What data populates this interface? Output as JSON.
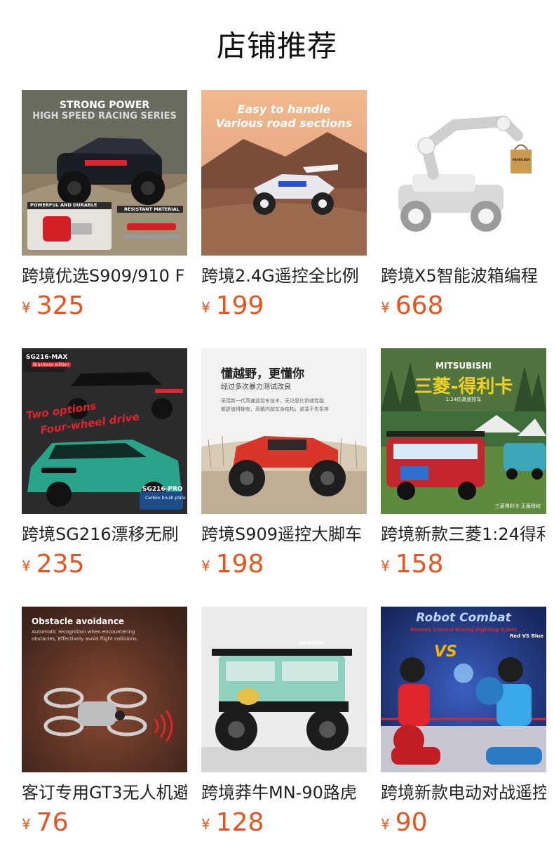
{
  "page": {
    "title": "店铺推荐"
  },
  "currency_symbol": "¥",
  "products": [
    {
      "name": "跨境优选S909/910 F",
      "price": "325",
      "image_text": {
        "line1": "STRONG POWER",
        "line2": "HIGH SPEED RACING SERIES",
        "tag1": "POWERFUL AND DURABLE",
        "tag2": "RESISTANT MATERIAL"
      },
      "colors": {
        "sky": "#6b6a5e",
        "ground": "#8d7c62",
        "car": "#1a1d24",
        "accent": "#e0242c"
      }
    },
    {
      "name": "跨境2.4G遥控全比例",
      "price": "199",
      "image_text": {
        "line1": "Easy to handle",
        "line2": "Various road sections"
      },
      "colors": {
        "sky": "#e9b48f",
        "ground": "#8a5a42",
        "car": "#e8e8ee",
        "accent": "#2a53c9"
      }
    },
    {
      "name": "跨境X5智能波箱编程",
      "price": "668",
      "image_text": {
        "label": "PAPER BOX"
      },
      "colors": {
        "sky": "#ffffff",
        "ground": "#ffffff",
        "car": "#e7e7e7",
        "accent": "#c99a4f"
      }
    },
    {
      "name": "跨境SG216漂移无刷",
      "price": "235",
      "image_text": {
        "tag_top": "SG216-MAX",
        "tag_top_sub": "Brushless edition",
        "line1": "Two options",
        "line2": "Four-wheel drive",
        "tag_bottom": "SG216-PRO",
        "tag_bottom_sub": "Carbon brush plate"
      },
      "colors": {
        "sky": "#2b2b2d",
        "ground": "#1e1f21",
        "car": "#2aa38b",
        "accent": "#e0242c"
      }
    },
    {
      "name": "跨境S909遥控大脚车",
      "price": "198",
      "image_text": {
        "line1": "懂越野，更懂你",
        "line2": "经过多次暴力测试改良",
        "line3": "采用新一代高速遥控车技术，无论是比例或性能",
        "line4": "都更值得拥有，高精内部车身结构，紧凑不失条序"
      },
      "colors": {
        "sky": "#f3f2f0",
        "ground": "#bfae95",
        "car": "#d8352b",
        "accent": "#1e1e1e"
      }
    },
    {
      "name": "跨境新款三菱1:24得利",
      "price": "158",
      "image_text": {
        "brand": "MITSUBISHI",
        "line1": "三菱-得利卡",
        "line2": "1:24仿真遥控车",
        "footer": "三菱得利卡 正版授权"
      },
      "colors": {
        "sky": "#3f6d3a",
        "ground": "#5e8a3e",
        "car": "#c4262e",
        "accent": "#f0d126"
      }
    },
    {
      "name": "客订专用GT3无人机避障",
      "price": "76",
      "image_text": {
        "line1": "Obstacle avoidance",
        "line2": "Automatic recognition when encountering",
        "line3": "obstacles, Effectively avoid flight collisions."
      },
      "colors": {
        "sky": "#5a3529",
        "ground": "#8a4a32",
        "car": "#c9c9c9",
        "accent": "#e0242c"
      }
    },
    {
      "name": "跨境莽牛MN-90路虎",
      "price": "128",
      "image_text": {
        "label": "DEFENDER"
      },
      "colors": {
        "sky": "#ececec",
        "ground": "#d6d6d6",
        "car": "#8fd1bf",
        "accent": "#1a1a1a"
      }
    },
    {
      "name": "跨境新款电动对战遥控",
      "price": "90",
      "image_text": {
        "line1": "Robot Combat",
        "line2": "Remote Control Boxing Fighting Robot",
        "line3": "Red VS Blue",
        "vs": "VS"
      },
      "colors": {
        "sky": "#1b2e6b",
        "ground": "#2c4aa0",
        "car": "#e0242c",
        "accent": "#3aa7e8"
      }
    }
  ]
}
